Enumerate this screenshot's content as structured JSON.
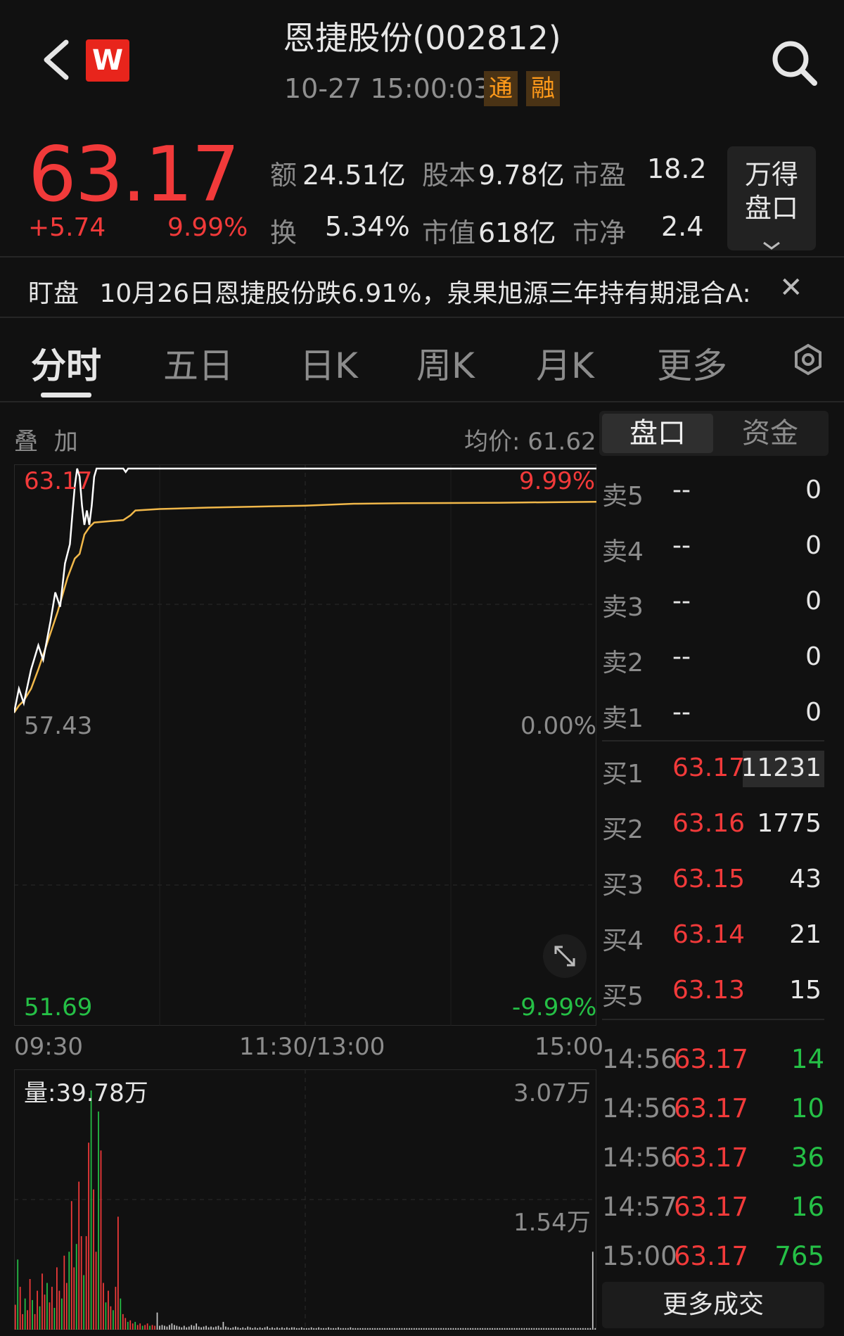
{
  "header": {
    "title": "恩捷股份(002812)",
    "datetime": "10-27 15:00:03",
    "tags": [
      "通",
      "融"
    ],
    "logo_letter": "W"
  },
  "quote": {
    "price": "63.17",
    "change": "+5.74",
    "change_pct": "9.99%",
    "stats": [
      {
        "label": "额",
        "value": "24.51亿"
      },
      {
        "label": "股本",
        "value": "9.78亿"
      },
      {
        "label": "市盈",
        "value": "18.2"
      },
      {
        "label": "换",
        "value": "5.34%"
      },
      {
        "label": "市值",
        "value": "618亿"
      },
      {
        "label": "市净",
        "value": "2.4"
      }
    ],
    "wande_button": [
      "万得",
      "盘口"
    ]
  },
  "alert": {
    "label": "盯盘",
    "text": "10月26日恩捷股份跌6.91%，泉果旭源三年持有期混合A:"
  },
  "tabs": [
    "分时",
    "五日",
    "日K",
    "周K",
    "月K",
    "更多"
  ],
  "chart_header": {
    "overlay_label": "叠 加",
    "avg_price": "均价: 61.62",
    "segments": [
      "盘口",
      "资金"
    ]
  },
  "chart_data": {
    "type": "line",
    "price_axis": {
      "top": "63.17",
      "mid": "57.43",
      "bottom": "51.69"
    },
    "pct_axis": {
      "top": "9.99%",
      "mid": "0.00%",
      "bottom": "-9.99%"
    },
    "time_labels": [
      "09:30",
      "11:30/13:00",
      "15:00"
    ],
    "ylim": [
      51.69,
      63.17
    ],
    "minutes_total": 240,
    "series": [
      {
        "role": "price",
        "color": "#ffffff",
        "points": [
          [
            0,
            58.1
          ],
          [
            2,
            58.6
          ],
          [
            4,
            58.3
          ],
          [
            7,
            59.0
          ],
          [
            10,
            59.5
          ],
          [
            12,
            59.2
          ],
          [
            15,
            60.0
          ],
          [
            17,
            60.6
          ],
          [
            19,
            60.3
          ],
          [
            21,
            61.2
          ],
          [
            23,
            61.6
          ],
          [
            24,
            62.2
          ],
          [
            25,
            62.8
          ],
          [
            26,
            63.17
          ],
          [
            27,
            63.0
          ],
          [
            28,
            62.4
          ],
          [
            29,
            62.0
          ],
          [
            30,
            62.3
          ],
          [
            31,
            62.0
          ],
          [
            32,
            62.4
          ],
          [
            33,
            63.0
          ],
          [
            34,
            63.17
          ],
          [
            36,
            63.17
          ],
          [
            40,
            63.17
          ],
          [
            45,
            63.17
          ],
          [
            46,
            63.1
          ],
          [
            47,
            63.17
          ],
          [
            60,
            63.17
          ],
          [
            100,
            63.17
          ],
          [
            140,
            63.17
          ],
          [
            200,
            63.17
          ],
          [
            240,
            63.17
          ]
        ]
      },
      {
        "role": "average",
        "color": "#f1b84a",
        "points": [
          [
            0,
            58.1
          ],
          [
            2,
            58.25
          ],
          [
            4,
            58.35
          ],
          [
            7,
            58.6
          ],
          [
            10,
            59.0
          ],
          [
            14,
            59.6
          ],
          [
            18,
            60.2
          ],
          [
            22,
            60.9
          ],
          [
            25,
            61.3
          ],
          [
            27,
            61.4
          ],
          [
            29,
            61.8
          ],
          [
            31,
            61.95
          ],
          [
            33,
            62.05
          ],
          [
            40,
            62.08
          ],
          [
            45,
            62.1
          ],
          [
            48,
            62.2
          ],
          [
            50,
            62.3
          ],
          [
            60,
            62.33
          ],
          [
            80,
            62.36
          ],
          [
            100,
            62.38
          ],
          [
            120,
            62.4
          ],
          [
            140,
            62.44
          ],
          [
            160,
            62.45
          ],
          [
            200,
            62.46
          ],
          [
            240,
            62.48
          ]
        ]
      }
    ],
    "volume": {
      "label": "量:39.78万",
      "max_label": "3.07万",
      "mid_label": "1.54万",
      "max_value": 3.07,
      "bars": [
        0.32,
        0.9,
        0.55,
        0.2,
        0.4,
        0.25,
        0.65,
        0.38,
        0.2,
        0.5,
        0.3,
        0.72,
        0.45,
        0.6,
        0.35,
        0.55,
        0.28,
        0.8,
        0.5,
        0.4,
        0.95,
        0.6,
        1.0,
        1.65,
        0.8,
        1.1,
        1.9,
        1.2,
        0.7,
        1.2,
        2.4,
        3.07,
        1.8,
        1.0,
        2.8,
        2.3,
        0.6,
        0.35,
        0.5,
        0.3,
        0.25,
        0.55,
        1.45,
        0.4,
        0.2,
        0.15,
        0.1,
        0.12,
        0.08,
        0.1,
        0.06,
        0.08,
        0.05,
        0.06,
        0.08,
        0.05,
        0.06,
        0.05,
        0.22,
        0.05,
        0.06,
        0.05,
        0.04,
        0.06,
        0.08,
        0.06,
        0.05,
        0.04,
        0.03,
        0.05,
        0.03,
        0.04,
        0.06,
        0.05,
        0.08,
        0.04,
        0.03,
        0.04,
        0.05,
        0.03,
        0.04,
        0.03,
        0.04,
        0.05,
        0.03,
        0.1,
        0.04,
        0.03,
        0.02,
        0.03,
        0.04,
        0.03,
        0.02,
        0.03,
        0.02,
        0.04,
        0.03,
        0.02,
        0.03,
        0.02,
        0.03,
        0.02,
        0.03,
        0.04,
        0.02,
        0.03,
        0.02,
        0.03,
        0.02,
        0.03,
        0.02,
        0.03,
        0.02,
        0.03,
        0.03,
        0.02,
        0.02,
        0.03,
        0.02,
        0.02,
        0.02,
        0.03,
        0.02,
        0.02,
        0.03,
        0.02,
        0.02,
        0.02,
        0.03,
        0.02,
        0.02,
        0.02,
        0.03,
        0.02,
        0.02,
        0.02,
        0.02,
        0.03,
        0.02,
        0.02,
        0.02,
        0.02,
        0.02,
        0.02,
        0.02,
        0.02,
        0.02,
        0.02,
        0.02,
        0.02,
        0.02,
        0.02,
        0.02,
        0.02,
        0.02,
        0.02,
        0.02,
        0.02,
        0.02,
        0.02,
        0.02,
        0.02,
        0.02,
        0.02,
        0.02,
        0.02,
        0.02,
        0.02,
        0.02,
        0.02,
        0.02,
        0.02,
        0.02,
        0.02,
        0.02,
        0.02,
        0.02,
        0.02,
        0.02,
        0.02,
        0.02,
        0.02,
        0.02,
        0.02,
        0.02,
        0.02,
        0.02,
        0.02,
        0.02,
        0.02,
        0.02,
        0.02,
        0.02,
        0.02,
        0.02,
        0.02,
        0.02,
        0.02,
        0.02,
        0.02,
        0.02,
        0.02,
        0.02,
        0.02,
        0.02,
        0.02,
        0.02,
        0.02,
        0.02,
        0.02,
        0.02,
        0.02,
        0.02,
        0.02,
        0.02,
        0.02,
        0.02,
        0.02,
        0.02,
        0.02,
        0.02,
        0.02,
        0.02,
        0.02,
        0.02,
        0.02,
        0.02,
        0.02,
        0.02,
        0.02,
        0.02,
        0.02,
        0.02,
        0.02,
        0.02,
        0.02,
        1.0,
        0.02
      ]
    }
  },
  "order_book": {
    "asks": [
      {
        "label": "卖5",
        "price": "--",
        "vol": "0"
      },
      {
        "label": "卖4",
        "price": "--",
        "vol": "0"
      },
      {
        "label": "卖3",
        "price": "--",
        "vol": "0"
      },
      {
        "label": "卖2",
        "price": "--",
        "vol": "0"
      },
      {
        "label": "卖1",
        "price": "--",
        "vol": "0"
      }
    ],
    "bids": [
      {
        "label": "买1",
        "price": "63.17",
        "vol": "11231"
      },
      {
        "label": "买2",
        "price": "63.16",
        "vol": "1775"
      },
      {
        "label": "买3",
        "price": "63.15",
        "vol": "43"
      },
      {
        "label": "买4",
        "price": "63.14",
        "vol": "21"
      },
      {
        "label": "买5",
        "price": "63.13",
        "vol": "15"
      }
    ]
  },
  "ticks": [
    {
      "time": "14:56",
      "price": "63.17",
      "vol": "14"
    },
    {
      "time": "14:56",
      "price": "63.17",
      "vol": "10"
    },
    {
      "time": "14:56",
      "price": "63.17",
      "vol": "36"
    },
    {
      "time": "14:57",
      "price": "63.17",
      "vol": "16"
    },
    {
      "time": "15:00",
      "price": "63.17",
      "vol": "765"
    }
  ],
  "more_trades": "更多成交",
  "colors": {
    "up": "#f23a3a",
    "down": "#25c046",
    "accent": "#ff9a1a",
    "bg": "#111111"
  }
}
